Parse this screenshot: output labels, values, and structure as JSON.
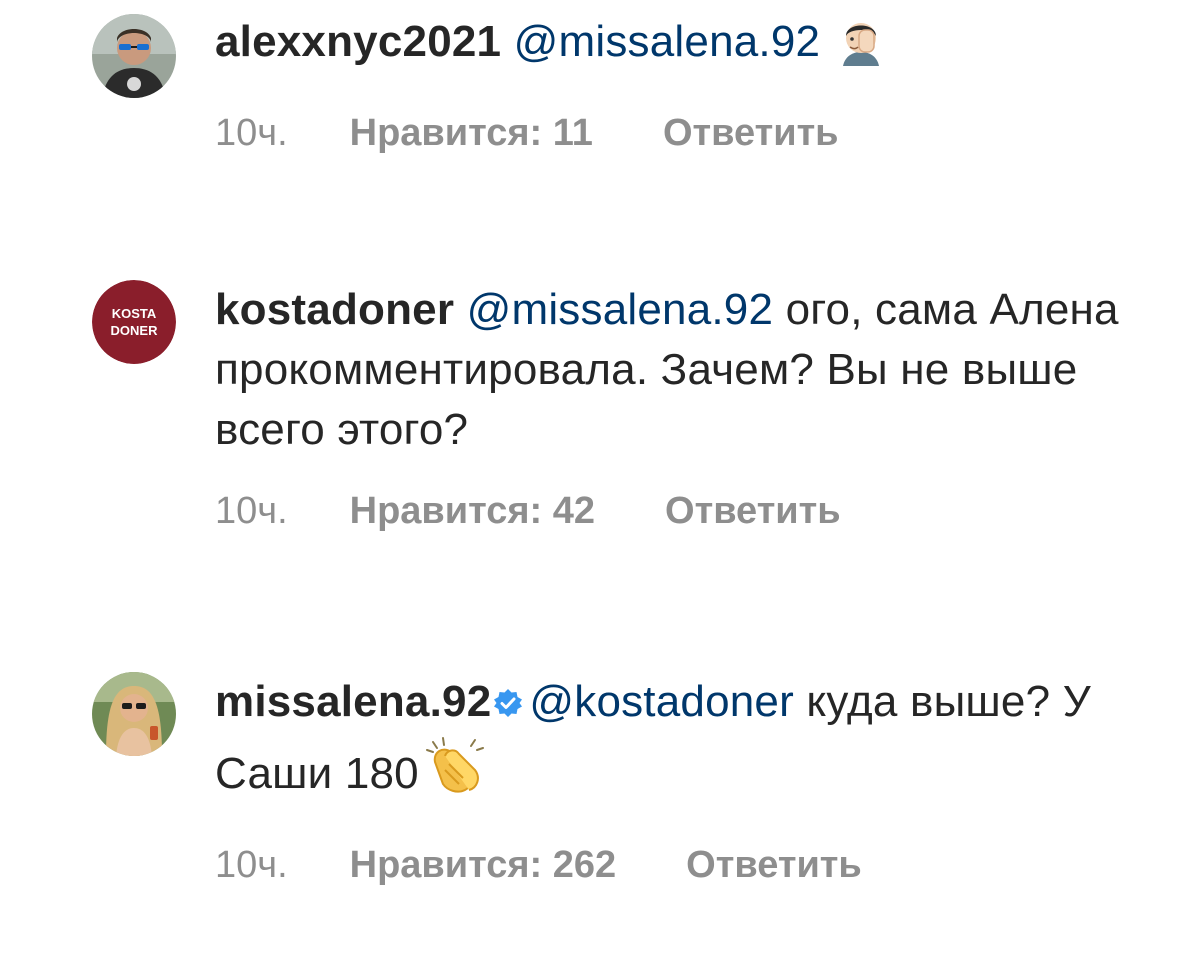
{
  "colors": {
    "text": "#262626",
    "mention": "#00376b",
    "meta": "#8e8e8e",
    "verified_badge": "#3897f0",
    "kostadoner_brand": "#8a1e2b"
  },
  "comments": [
    {
      "username": "alexxnyc2021",
      "avatar_icon": "user-photo-sunglasses",
      "mention": "@missalena.92",
      "text_after_mention": "",
      "emoji": "facepalm-emoji",
      "time": "10ч.",
      "likes": "Нравится: 11",
      "reply": "Ответить"
    },
    {
      "username": "kostadoner",
      "avatar_icon": "kosta-doner-logo",
      "avatar_text_line1": "KOSTA",
      "avatar_text_line2": "DONER",
      "mention": "@missalena.92",
      "text_after_mention": " ого, сама Алена прокомментировала. Зачем? Вы не выше всего этого?",
      "time": "10ч.",
      "likes": "Нравится: 42",
      "reply": "Ответить"
    },
    {
      "username": "missalena.92",
      "avatar_icon": "user-photo-blonde",
      "verified_icon": "verified-badge-icon",
      "mention": "@kostadoner",
      "text_after_mention": " куда выше? У Саши 180",
      "emoji": "clapping-hands-emoji",
      "time": "10ч.",
      "likes": "Нравится: 262",
      "reply": "Ответить"
    }
  ]
}
